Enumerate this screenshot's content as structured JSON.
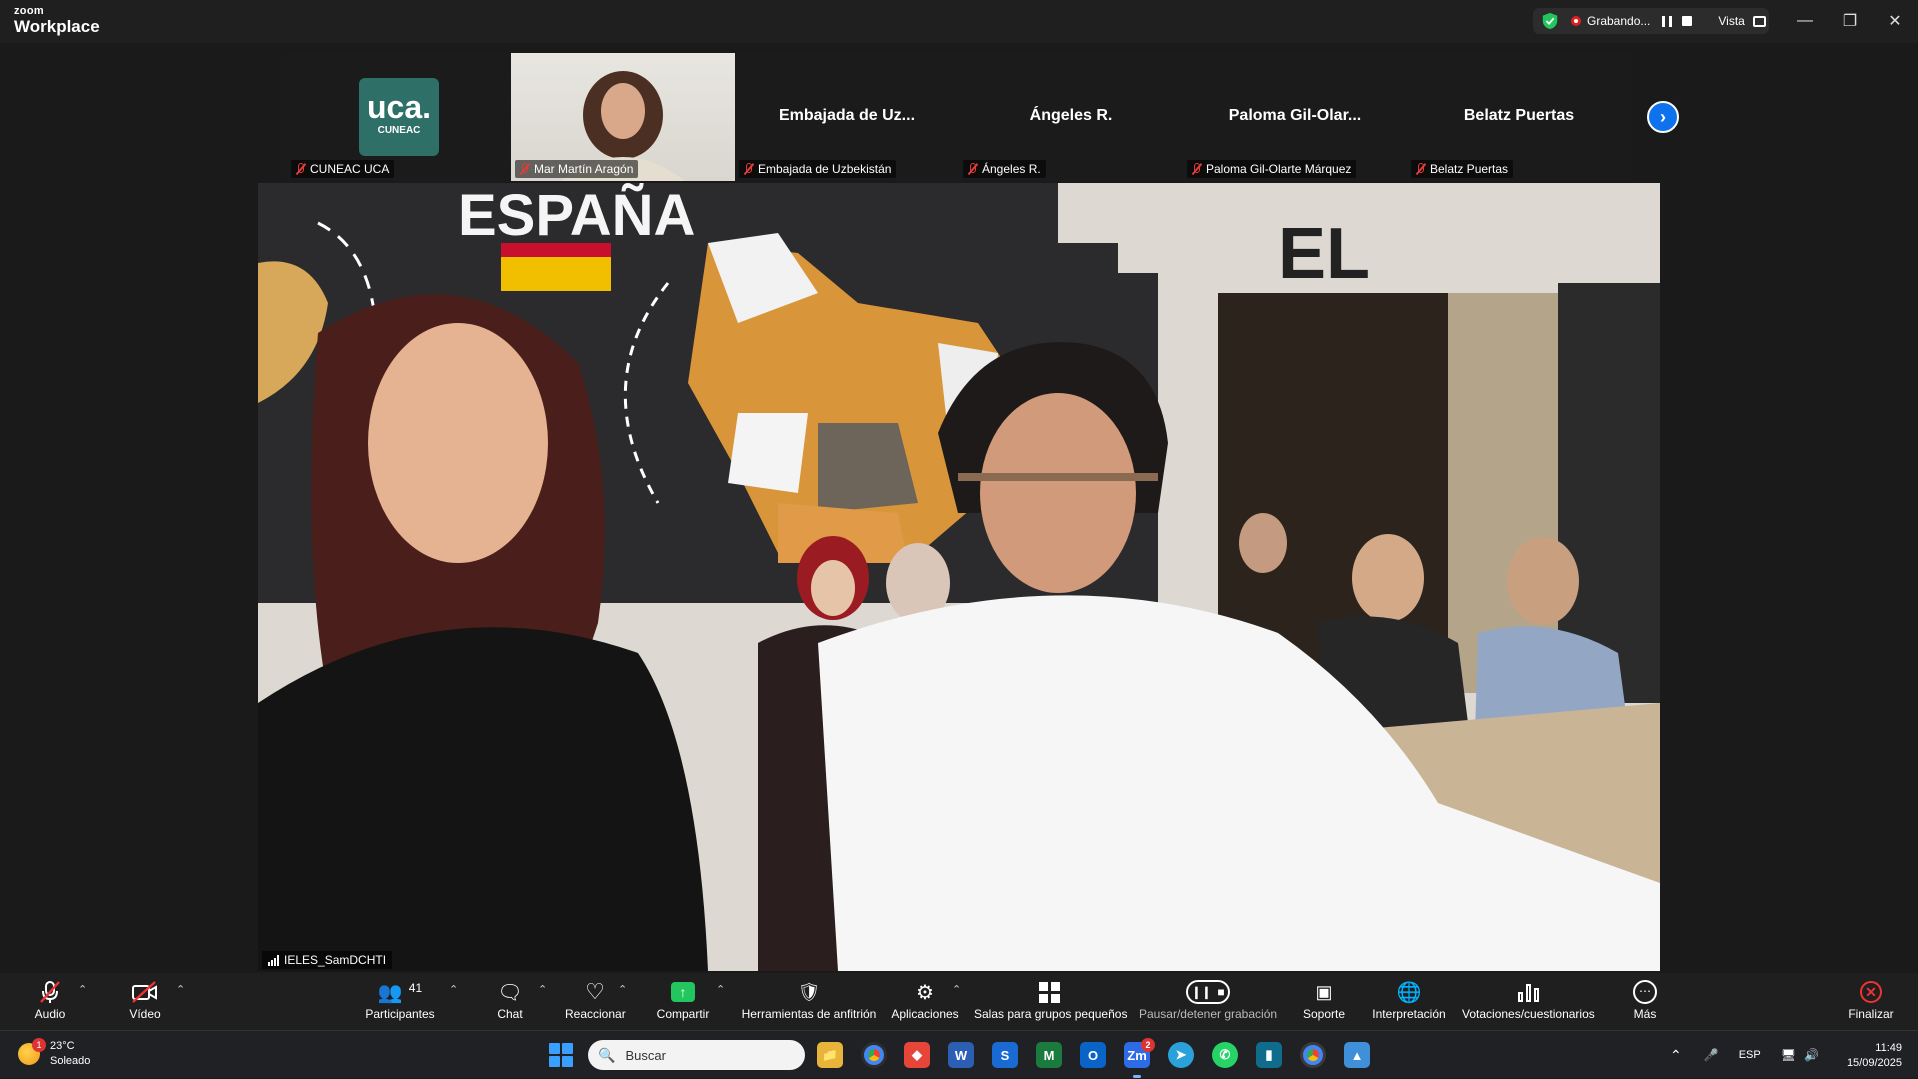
{
  "app": {
    "brand_top": "zoom",
    "brand_bottom": "Workplace"
  },
  "recording": {
    "status": "Grabando...",
    "view_label": "Vista"
  },
  "gallery": {
    "tiles": [
      {
        "name": "",
        "label": "CUNEAC UCA",
        "logo_big": "uca.",
        "logo_small": "CUNEAC"
      },
      {
        "name": "",
        "label": "Mar Martín Aragón"
      },
      {
        "name": "Embajada  de  Uz...",
        "label": "Embajada de Uzbekistán"
      },
      {
        "name": "Ángeles R.",
        "label": "Ángeles R."
      },
      {
        "name": "Paloma  Gil-Olar...",
        "label": "Paloma Gil-Olarte Márquez"
      },
      {
        "name": "Belatz Puertas",
        "label": "Belatz Puertas"
      }
    ]
  },
  "main_video": {
    "speaker_label": "IELES_SamDCHTI",
    "sign_text": "ESPAÑA",
    "sign_text_2": "EL"
  },
  "toolbar": {
    "audio": "Audio",
    "video": "Vídeo",
    "participants": "Participantes",
    "participants_count": "41",
    "chat": "Chat",
    "react": "Reaccionar",
    "share": "Compartir",
    "host_tools": "Herramientas de anfitrión",
    "apps": "Aplicaciones",
    "breakout": "Salas para grupos pequeños",
    "pause_rec": "Pausar/detener grabación",
    "support": "Soporte",
    "interpretation": "Interpretación",
    "polls": "Votaciones/cuestionarios",
    "more": "Más",
    "end": "Finalizar"
  },
  "taskbar": {
    "weather_temp": "23°C",
    "weather_desc": "Soleado",
    "weather_badge": "1",
    "search_placeholder": "Buscar",
    "zoom_badge": "2",
    "lang": "ESP",
    "time": "11:49",
    "date": "15/09/2025"
  },
  "colors": {
    "accent": "#0e72ed",
    "end": "#e33333",
    "share": "#22c55e",
    "uca_logo": "#2e6f67"
  }
}
